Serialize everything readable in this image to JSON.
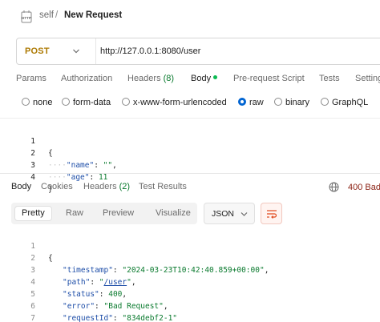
{
  "header": {
    "icon": "http-icon",
    "breadcrumb_parent": "self",
    "breadcrumb_sep": "/",
    "title": "New Request"
  },
  "request": {
    "method": "POST",
    "url": "http://127.0.0.1:8080/user"
  },
  "request_tabs": {
    "params": "Params",
    "authorization": "Authorization",
    "headers": "Headers",
    "headers_count": "(8)",
    "body": "Body",
    "pre_request": "Pre-request Script",
    "tests": "Tests",
    "settings": "Setting"
  },
  "body_types": {
    "none": "none",
    "form_data": "form-data",
    "urlencoded": "x-www-form-urlencoded",
    "raw": "raw",
    "binary": "binary",
    "graphql": "GraphQL",
    "selected": "raw"
  },
  "request_body": {
    "lines": [
      {
        "n": "1",
        "open": "{"
      },
      {
        "n": "2",
        "guide": "····",
        "key": "\"name\"",
        "colon": ": ",
        "value": "\"\"",
        "end": ","
      },
      {
        "n": "3",
        "guide": "····",
        "key": "\"age\"",
        "colon": ": ",
        "value": "11",
        "end": ""
      },
      {
        "n": "4",
        "close": "}"
      }
    ]
  },
  "response_tabs": {
    "body": "Body",
    "cookies": "Cookies",
    "headers": "Headers",
    "headers_count": "(2)",
    "test_results": "Test Results"
  },
  "response_status": "400 Bad",
  "response_view": {
    "pretty": "Pretty",
    "raw": "Raw",
    "preview": "Preview",
    "visualize": "Visualize",
    "selected": "Pretty",
    "format": "JSON"
  },
  "response_body": {
    "lines": [
      {
        "n": "1",
        "open": "{"
      },
      {
        "n": "2",
        "key": "\"timestamp\"",
        "colon": ": ",
        "value": "\"2024-03-23T10:42:40.859+00:00\"",
        "end": ","
      },
      {
        "n": "3",
        "key": "\"path\"",
        "colon": ": ",
        "q1": "\"",
        "link": "/user",
        "q2": "\"",
        "end": ","
      },
      {
        "n": "4",
        "key": "\"status\"",
        "colon": ": ",
        "value": "400",
        "end": ","
      },
      {
        "n": "5",
        "key": "\"error\"",
        "colon": ": ",
        "value": "\"Bad Request\"",
        "end": ","
      },
      {
        "n": "6",
        "key": "\"requestId\"",
        "colon": ": ",
        "value": "\"834debf2-1\"",
        "end": ""
      },
      {
        "n": "7",
        "close": "}"
      }
    ]
  },
  "colors": {
    "method": "#ad7a03",
    "accent": "#0265d2",
    "status_error": "#8a1f11",
    "json_key": "#1e4ea8",
    "json_value": "#0a7a2e",
    "body_dot": "#0cbb52"
  }
}
